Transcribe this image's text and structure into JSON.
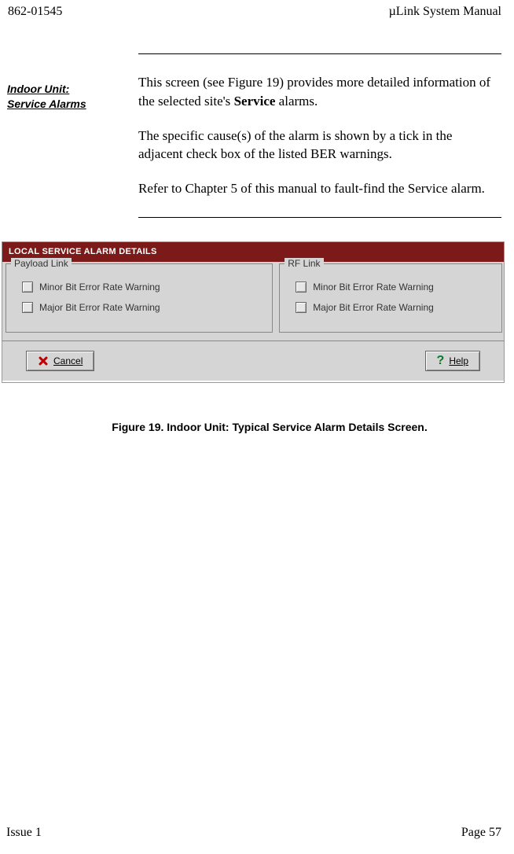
{
  "header": {
    "left": "862-01545",
    "right": "µLink System Manual"
  },
  "side_label": {
    "line1": "Indoor Unit:",
    "line2": "Service Alarms"
  },
  "paragraphs": {
    "p1_a": "This screen (see Figure 19) provides more detailed information of the selected site's ",
    "p1_b": "Service",
    "p1_c": " alarms.",
    "p2": "The specific cause(s) of the alarm is shown by a tick in the adjacent check box of the listed BER warnings.",
    "p3": "Refer to Chapter 5 of this manual to fault-find the Service alarm."
  },
  "panel": {
    "title": "LOCAL SERVICE ALARM DETAILS",
    "groups": [
      {
        "label": "Payload Link",
        "items": [
          "Minor Bit Error Rate Warning",
          "Major Bit Error Rate Warning"
        ]
      },
      {
        "label": "RF Link",
        "items": [
          "Minor Bit Error Rate Warning",
          "Major Bit Error Rate Warning"
        ]
      }
    ],
    "buttons": {
      "cancel": "Cancel",
      "help": "Help"
    }
  },
  "caption": "Figure 19.  Indoor Unit:  Typical Service Alarm Details Screen.",
  "footer": {
    "left": "Issue 1",
    "right": "Page 57"
  }
}
